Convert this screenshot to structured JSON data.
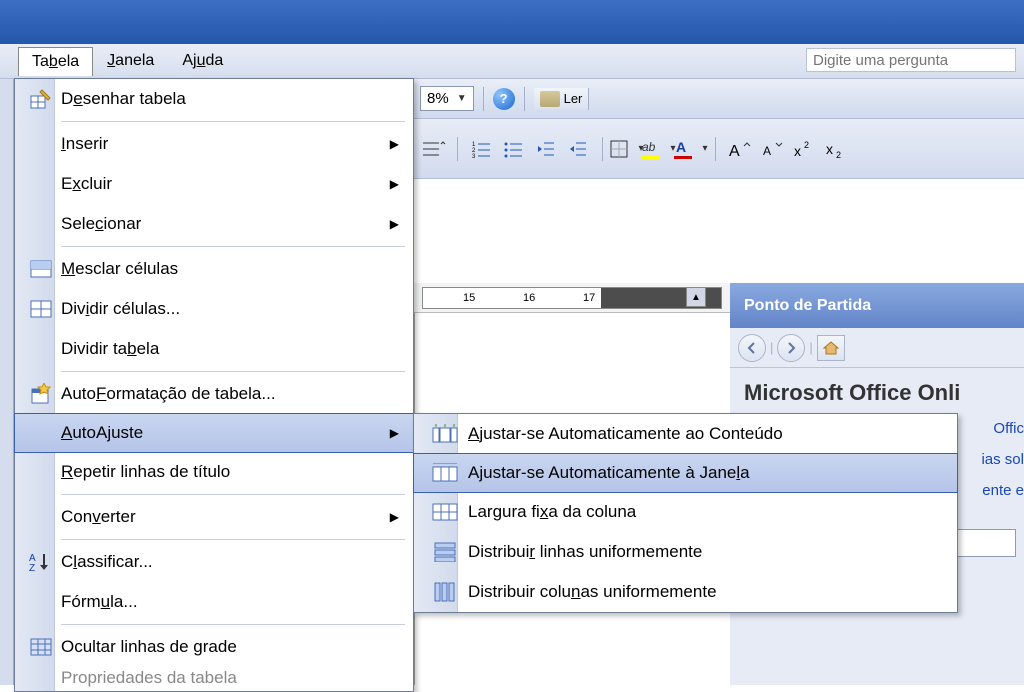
{
  "menubar": {
    "tabela": "Tabela",
    "janela": "Janela",
    "ajuda": "Ajuda"
  },
  "helpPlaceholder": "Digite uma pergunta",
  "zoom": "8%",
  "lerLabel": "Ler",
  "dropdown": {
    "desenhar": "Desenhar tabela",
    "inserir": "Inserir",
    "excluir": "Excluir",
    "selecionar": "Selecionar",
    "mesclar": "Mesclar células",
    "dividirCelulas": "Dividir células...",
    "dividirTabela": "Dividir tabela",
    "autoformatacao": "AutoFormatação de tabela...",
    "autoajuste": "AutoAjuste",
    "repetir": "Repetir linhas de título",
    "converter": "Converter",
    "classificar": "Classificar...",
    "formula": "Fórmula...",
    "ocultar": "Ocultar linhas de grade",
    "propriedades": "Propriedades da tabela"
  },
  "submenu": {
    "conteudo": "Ajustar-se Automaticamente ao Conteúdo",
    "janela": "Ajustar-se Automaticamente à Janela",
    "largura": "Largura fixa da coluna",
    "distribLinhas": "Distribuir linhas uniformemente",
    "distribColunas": "Distribuir colunas uniformemente"
  },
  "taskpane": {
    "header": "Ponto de Partida",
    "title": "Microsoft Office Onli",
    "link1": "Offic",
    "link2": "ias sol",
    "link3": "ente e"
  },
  "ruler": {
    "n15": "15",
    "n16": "16",
    "n17": "17"
  }
}
